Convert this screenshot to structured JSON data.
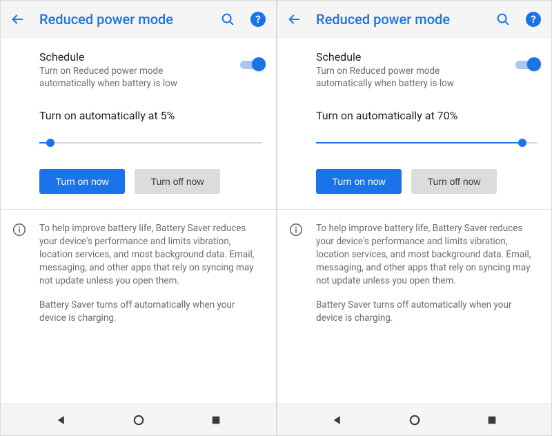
{
  "panes": [
    {
      "title": "Reduced power mode",
      "schedule_title": "Schedule",
      "schedule_sub": "Turn on Reduced power mode automatically when battery is low",
      "toggle_on": true,
      "slider_label": "Turn on automatically at 5%",
      "slider_percent": 5,
      "btn_on": "Turn on now",
      "btn_off": "Turn off now",
      "info_p1": "To help improve battery life, Battery Saver reduces your device's performance and limits vibration, location services, and most background data. Email, messaging, and other apps that rely on syncing may not update unless you open them.",
      "info_p2": "Battery Saver turns off automatically when your device is charging."
    },
    {
      "title": "Reduced power mode",
      "schedule_title": "Schedule",
      "schedule_sub": "Turn on Reduced power mode automatically when battery is low",
      "toggle_on": true,
      "slider_label": "Turn on automatically at 70%",
      "slider_percent": 93,
      "btn_on": "Turn on now",
      "btn_off": "Turn off now",
      "info_p1": "To help improve battery life, Battery Saver reduces your device's performance and limits vibration, location services, and most background data. Email, messaging, and other apps that rely on syncing may not update unless you open them.",
      "info_p2": "Battery Saver turns off automatically when your device is charging."
    }
  ]
}
